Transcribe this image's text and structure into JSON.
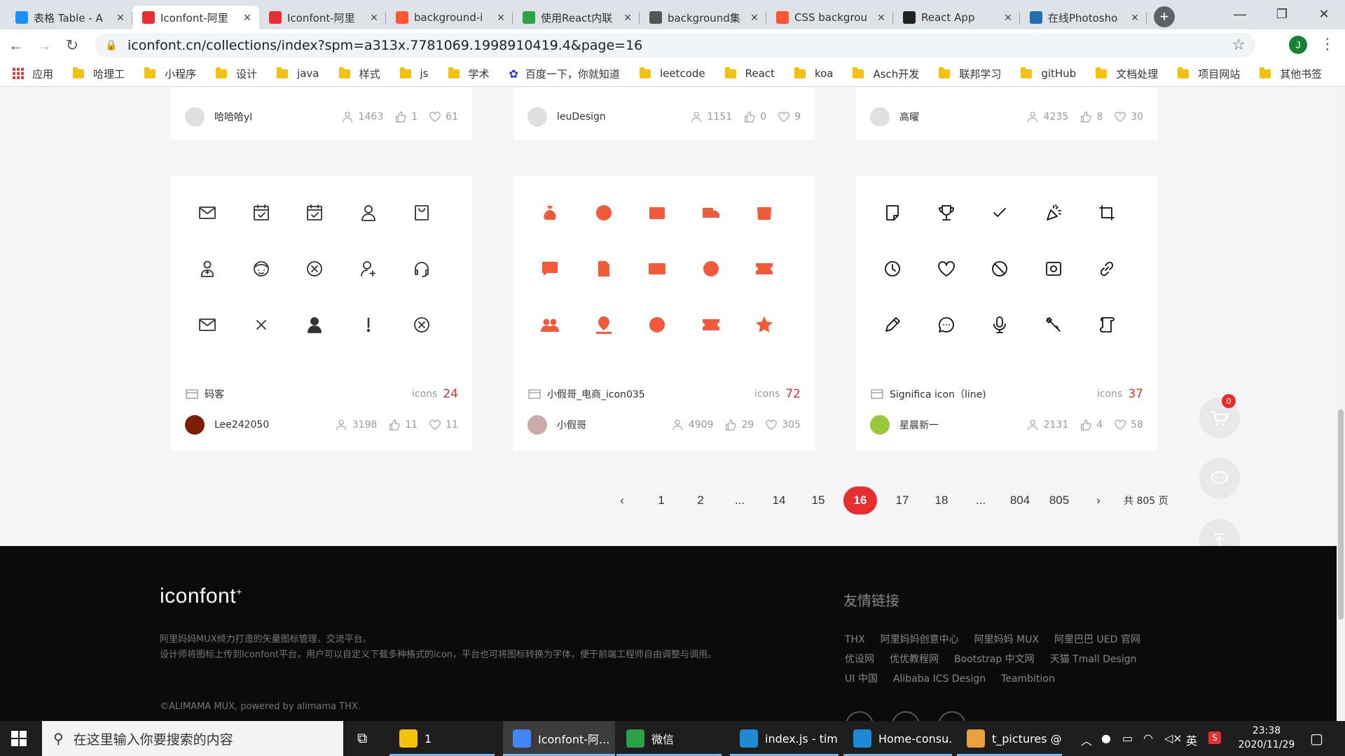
{
  "browser": {
    "tabs": [
      {
        "title": "表格 Table - A",
        "icon_color": "#1890ff"
      },
      {
        "title": "Iconfont-阿里",
        "icon_color": "#e62e2e",
        "active": true
      },
      {
        "title": "Iconfont-阿里",
        "icon_color": "#e62e2e"
      },
      {
        "title": "background-i",
        "icon_color": "#fc5531"
      },
      {
        "title": "使用React内联",
        "icon_color": "#2ba245"
      },
      {
        "title": "background集",
        "icon_color": "#555555"
      },
      {
        "title": "CSS backgrou",
        "icon_color": "#fc5531"
      },
      {
        "title": "React App",
        "icon_color": "#222222"
      },
      {
        "title": "在线Photosho",
        "icon_color": "#1f6fb2"
      }
    ],
    "url": "iconfont.cn/collections/index?spm=a313x.7781069.1998910419.4&page=16",
    "profile_initial": "J",
    "bookmarks": [
      "应用",
      "哈理工",
      "小程序",
      "设计",
      "java",
      "样式",
      "js",
      "学术",
      "百度一下，你就知道",
      "leetcode",
      "React",
      "koa",
      "Asch开发",
      "联邦学习",
      "gitHub",
      "文档处理",
      "项目网站",
      "其他书签"
    ]
  },
  "top_row": [
    {
      "user": "哈哈哈yl",
      "views": "1463",
      "likes": "1",
      "favs": "61"
    },
    {
      "user": "leuDesign",
      "views": "1151",
      "likes": "0",
      "favs": "9"
    },
    {
      "user": "高曜",
      "views": "4235",
      "likes": "8",
      "favs": "30"
    }
  ],
  "collections": [
    {
      "name": "码客",
      "icons_label": "icons",
      "count": "24",
      "user": "Lee242050",
      "views": "3198",
      "likes": "11",
      "favs": "11",
      "icon_color": "#333333"
    },
    {
      "name": "小假哥_电商_icon035",
      "icons_label": "icons",
      "count": "72",
      "user": "小假哥",
      "views": "4909",
      "likes": "29",
      "favs": "305",
      "icon_color": "#f25a3a"
    },
    {
      "name": "Significa icon（line)",
      "icons_label": "icons",
      "count": "37",
      "user": "星晨新一",
      "views": "2131",
      "likes": "4",
      "favs": "58",
      "icon_color": "#111111"
    }
  ],
  "pagination": {
    "prev": "‹",
    "pages": [
      "1",
      "2",
      "...",
      "14",
      "15",
      "16",
      "17",
      "18",
      "...",
      "804",
      "805"
    ],
    "current": "16",
    "next": "›",
    "total": "共 805 页"
  },
  "cart_badge": "0",
  "footer": {
    "logo": "iconfont",
    "desc_line1": "阿里妈妈MUX倾力打造的矢量图标管理、交流平台。",
    "desc_line2": "设计师将图标上传到Iconfont平台，用户可以自定义下载多种格式的icon，平台也可将图标转换为字体，便于前端工程师自由调整与调用。",
    "copyright": "©ALIMAMA MUX, powered by alimama THX.",
    "links_title": "友情链接",
    "links": [
      "THX",
      "阿里妈妈创意中心",
      "阿里妈妈 MUX",
      "阿里巴巴 UED 官网",
      "优设网",
      "优优教程网",
      "Bootstrap 中文网",
      "天猫 Tmall Design",
      "UI 中国",
      "Alibaba ICS Design",
      "Teambition"
    ]
  },
  "taskbar": {
    "search_placeholder": "在这里输入你要搜索的内容",
    "items": [
      {
        "label": "1",
        "icon_color": "#f4c20d"
      },
      {
        "label": "Iconfont-阿...",
        "icon_color": "#4285f4",
        "active": true
      },
      {
        "label": "微信",
        "icon_color": "#2ba245"
      },
      {
        "label": "index.js - tim...",
        "icon_color": "#1f8ad2"
      },
      {
        "label": "Home-consu...",
        "icon_color": "#1f8ad2"
      },
      {
        "label": "t_pictures @...",
        "icon_color": "#e9a23b"
      }
    ],
    "tray_lang": "英",
    "time": "23:38",
    "date": "2020/11/29"
  }
}
